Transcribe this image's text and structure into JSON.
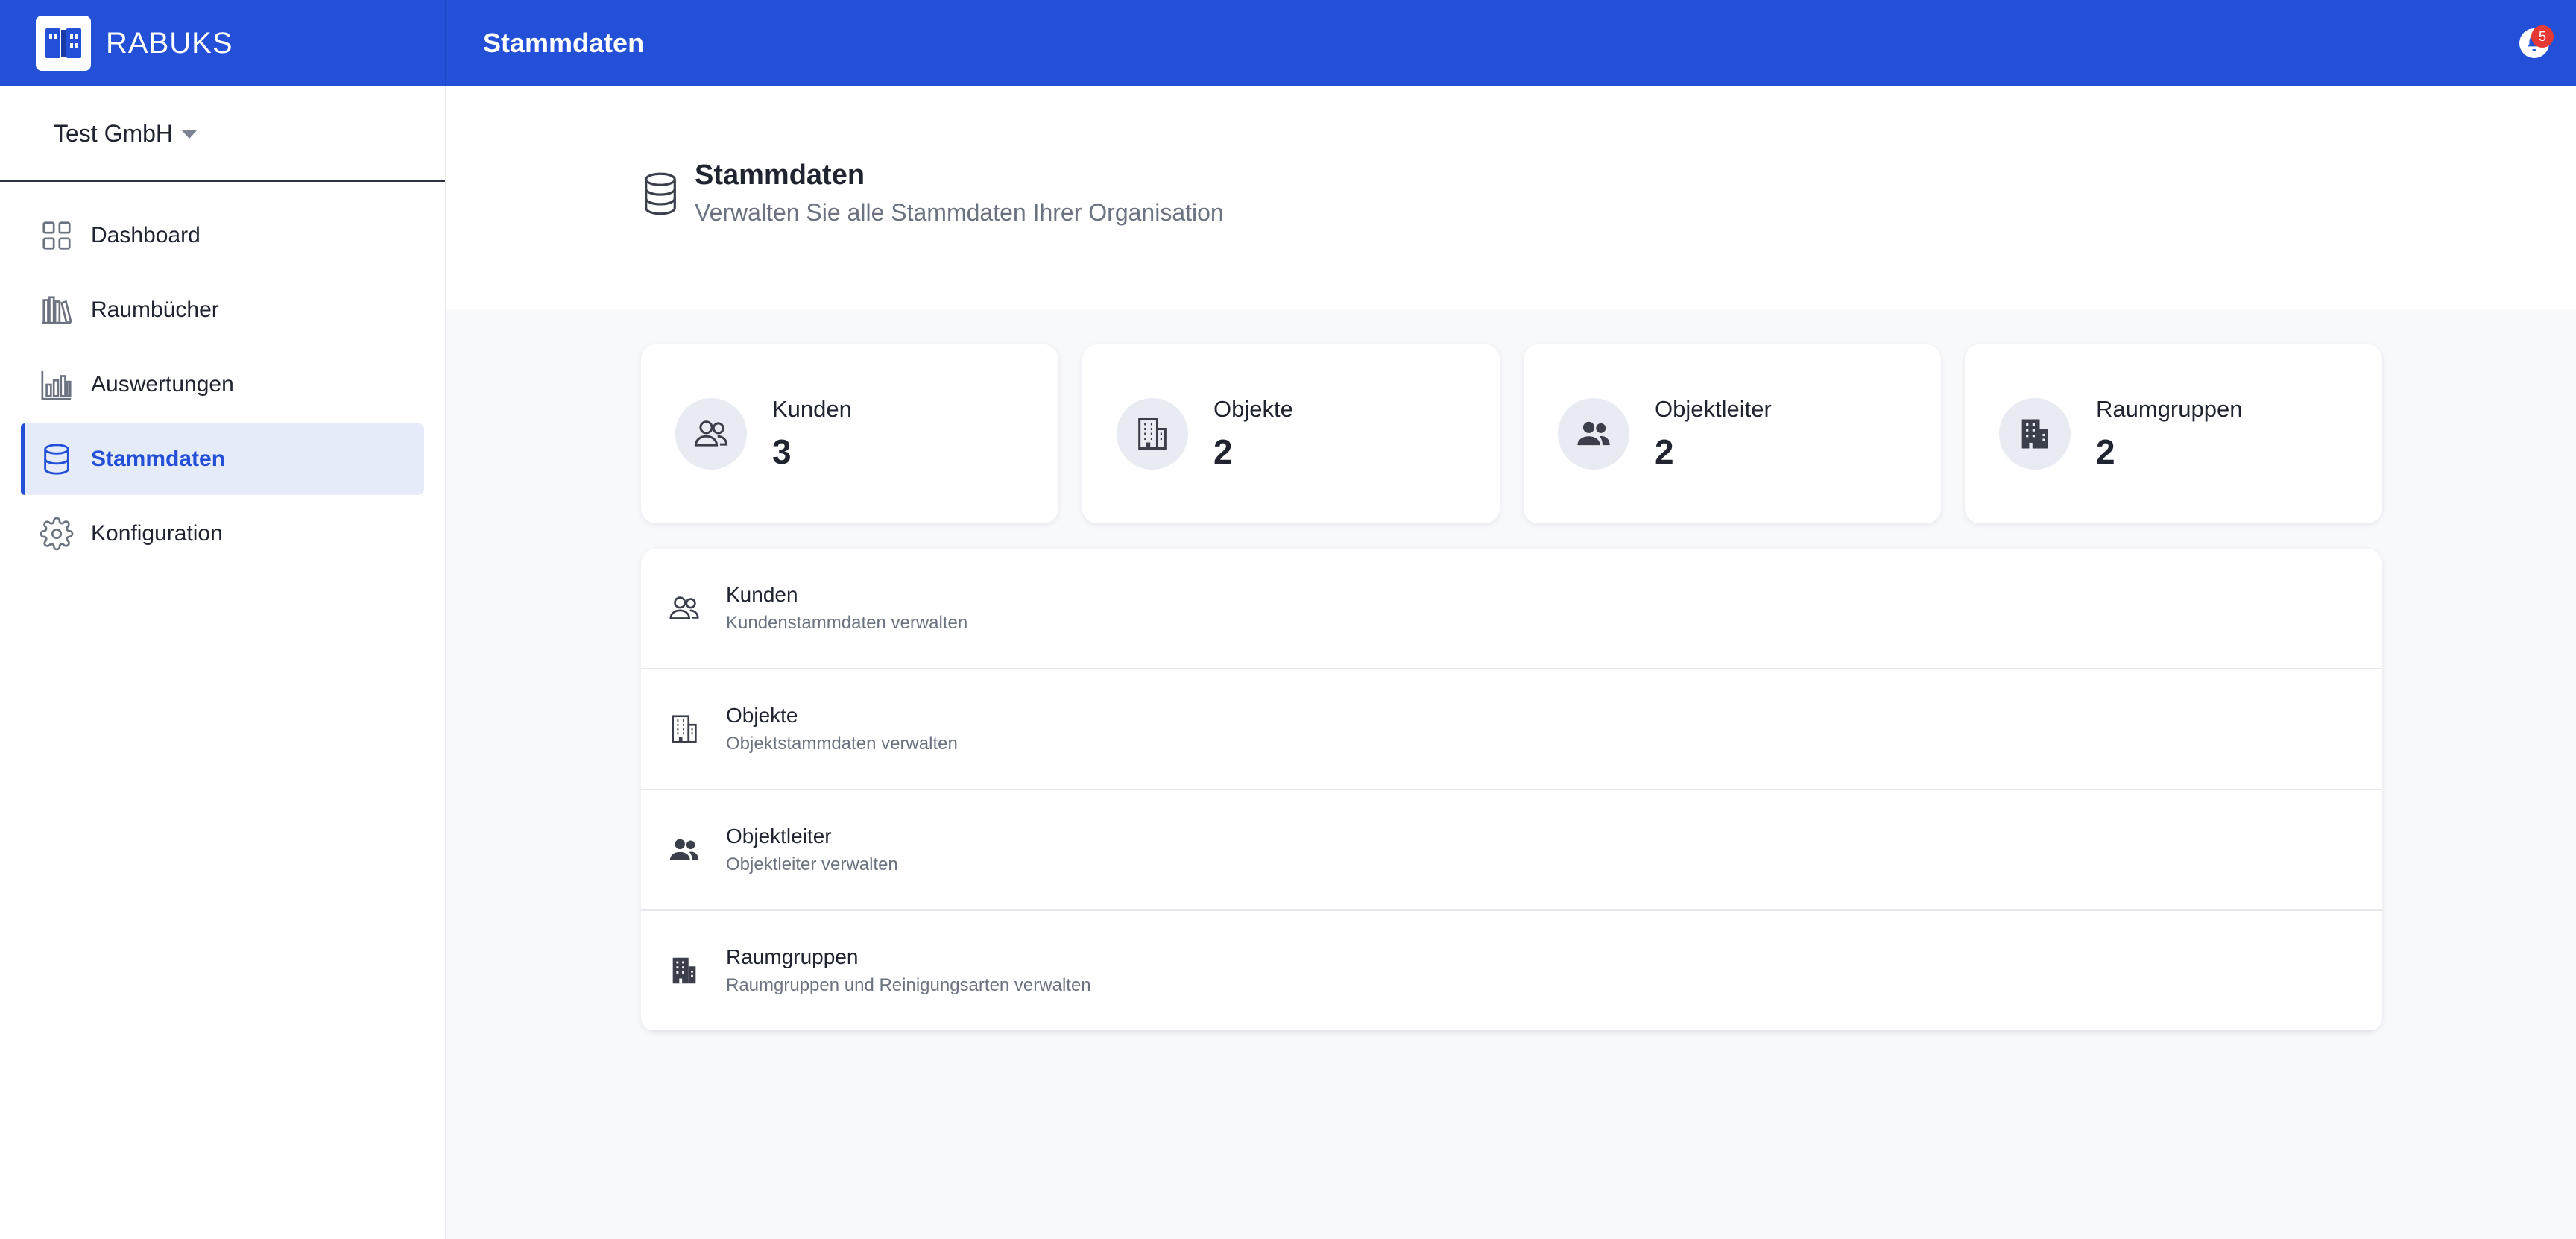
{
  "app": {
    "name": "RABUKS",
    "page_title": "Stammdaten",
    "notification_count": "5"
  },
  "sidebar": {
    "org_name": "Test GmbH",
    "items": [
      {
        "label": "Dashboard",
        "icon": "dashboard-grid-icon",
        "active": false
      },
      {
        "label": "Raumbücher",
        "icon": "books-icon",
        "active": false
      },
      {
        "label": "Auswertungen",
        "icon": "bar-chart-icon",
        "active": false
      },
      {
        "label": "Stammdaten",
        "icon": "database-icon",
        "active": true
      },
      {
        "label": "Konfiguration",
        "icon": "gear-icon",
        "active": false
      }
    ]
  },
  "header": {
    "title": "Stammdaten",
    "subtitle": "Verwalten Sie alle Stammdaten Ihrer Organisation",
    "icon": "database-icon"
  },
  "stats": [
    {
      "label": "Kunden",
      "value": "3",
      "icon": "users-outline-icon"
    },
    {
      "label": "Objekte",
      "value": "2",
      "icon": "building-outline-icon"
    },
    {
      "label": "Objektleiter",
      "value": "2",
      "icon": "users-filled-icon"
    },
    {
      "label": "Raumgruppen",
      "value": "2",
      "icon": "building-filled-icon"
    }
  ],
  "list": [
    {
      "title": "Kunden",
      "subtitle": "Kundenstammdaten verwalten",
      "icon": "users-outline-icon"
    },
    {
      "title": "Objekte",
      "subtitle": "Objektstammdaten verwalten",
      "icon": "building-outline-icon"
    },
    {
      "title": "Objektleiter",
      "subtitle": "Objektleiter verwalten",
      "icon": "users-filled-icon"
    },
    {
      "title": "Raumgruppen",
      "subtitle": "Raumgruppen und Reinigungsarten verwalten",
      "icon": "building-filled-icon"
    }
  ],
  "colors": {
    "primary": "#2450d8",
    "active_bg": "#e6ebfa",
    "badge": "#e53935"
  }
}
